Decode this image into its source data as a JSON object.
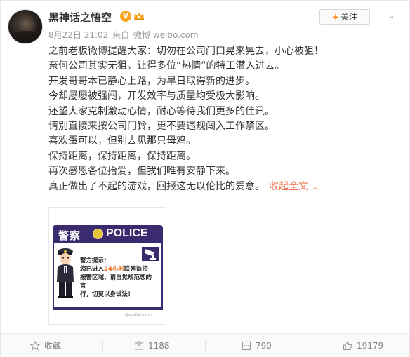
{
  "post": {
    "username": "黑神话之悟空",
    "verified_mark": "V",
    "follow_label": "关注",
    "follow_plus": "+",
    "date": "8月22日 21:02",
    "source_prefix": "来自",
    "source": "微博 weibo.com",
    "lines": [
      "之前老板微博提醒大家：切勿在公司门口晃来晃去，小心被狙！",
      "奈何公司其实无狙，让得多位“热情”的特工潜入进去。",
      "开发哥哥本已静心上路，为早日取得新的进步。",
      "今却屡屡被强闯，开发效率与质量均受极大影响。",
      "还望大家克制激动心情，耐心等待我们更多的佳讯。",
      "请别直接来按公司门铃，更不要违规闯入工作禁区。",
      "喜欢蛋可以，但别去见那只母鸡。",
      "保持距离，保持距离，保持距离。",
      "再次感恩各位抬爱，但我们唯有安静下来。",
      "真正做出了不起的游戏，回报这无以伦比的爱意。"
    ],
    "collapse_label": "收起全文",
    "image": {
      "header_cn": "警察",
      "header_en": "POLICE",
      "notice_line1": "警方提示：",
      "notice_line2_a": "您已进入",
      "notice_line2_hl": "24小时",
      "notice_line2_b": "联网监控",
      "notice_line3": "报警区域，请自觉规范您的言",
      "notice_line4": "行，切莫以身试法！",
      "watermark": "@weibo.com"
    }
  },
  "actions": {
    "favorite_label": "收藏",
    "repost_count": "1188",
    "comment_count": "790",
    "like_count": "19179"
  },
  "colors": {
    "link": "#eb7350",
    "verified": "#f6a623",
    "police_purple": "#3a2a6e"
  }
}
